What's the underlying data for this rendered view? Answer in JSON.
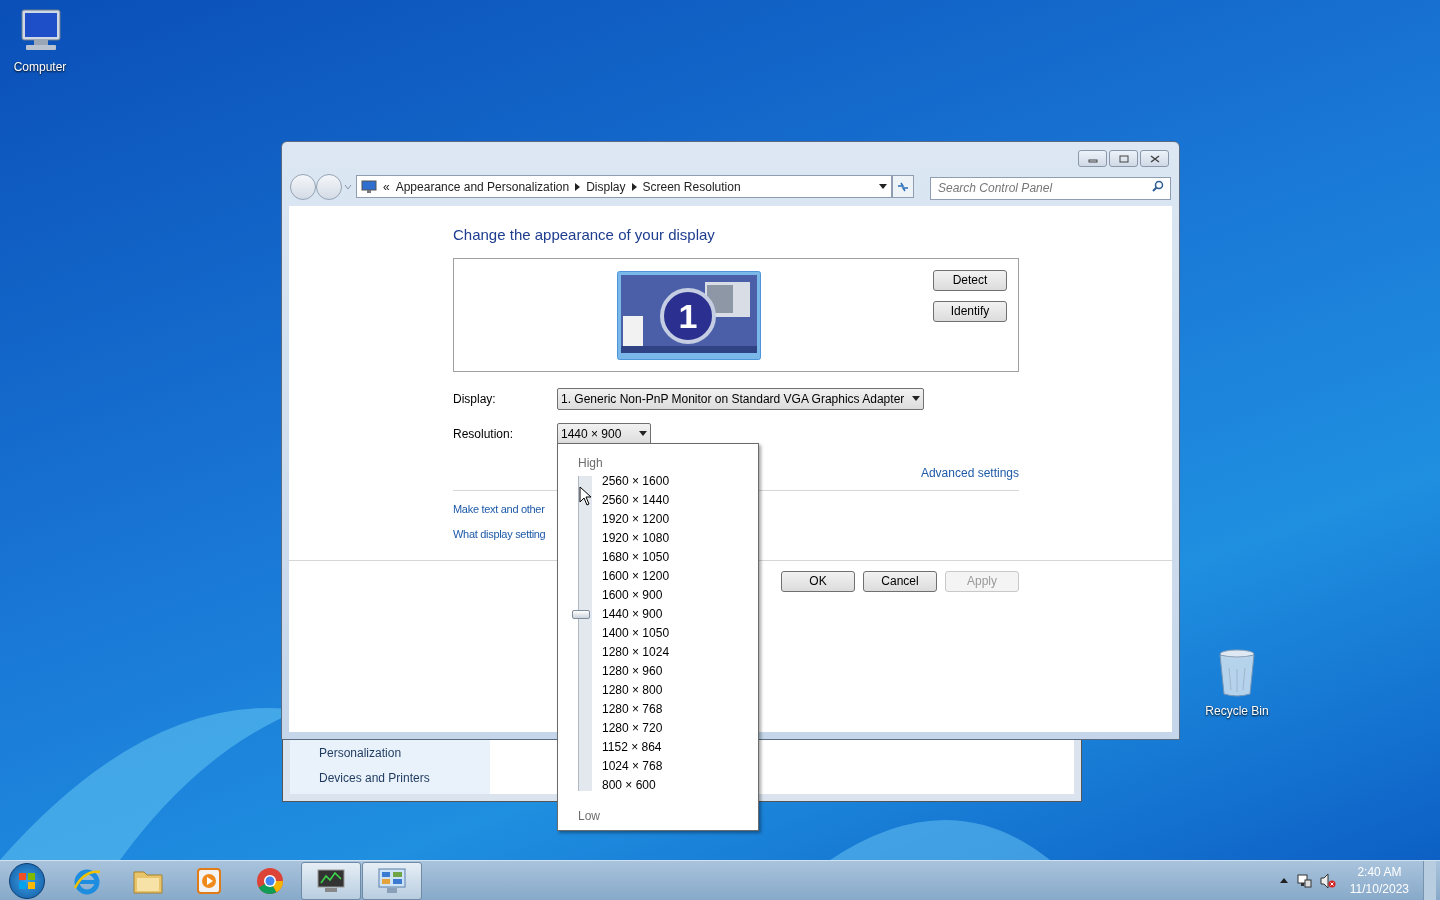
{
  "desktop_icons": [
    {
      "label": "Computer",
      "kind": "computer"
    },
    {
      "label": "Recycle Bin",
      "kind": "recycle"
    }
  ],
  "back_window": {
    "sidebar_items": [
      "Personalization",
      "Devices and Printers"
    ]
  },
  "window": {
    "breadcrumb_prefix": "«",
    "breadcrumb": [
      "Appearance and Personalization",
      "Display",
      "Screen Resolution"
    ],
    "search": {
      "placeholder": "Search Control Panel"
    },
    "heading": "Change the appearance of your display",
    "monitor_number": "1",
    "side_buttons": [
      "Detect",
      "Identify"
    ],
    "display": {
      "label": "Display:",
      "value": "1. Generic Non-PnP Monitor on Standard VGA Graphics Adapter"
    },
    "resolution": {
      "label": "Resolution:",
      "value": "1440 × 900"
    },
    "advanced_link": "Advanced settings",
    "links": [
      "Make text and other",
      "What display setting"
    ],
    "buttons": [
      {
        "label": "OK",
        "disabled": false
      },
      {
        "label": "Cancel",
        "disabled": false
      },
      {
        "label": "Apply",
        "disabled": true
      }
    ]
  },
  "resolution_popup": {
    "high_label": "High",
    "low_label": "Low",
    "level": 0.5625,
    "options": [
      "2560 × 1600",
      "2560 × 1440",
      "1920 × 1200",
      "1920 × 1080",
      "1680 × 1050",
      "1600 × 1200",
      "1600 × 900",
      "1440 × 900",
      "1400 × 1050",
      "1280 × 1024",
      "1280 × 960",
      "1280 × 800",
      "1280 × 768",
      "1280 × 720",
      "1152 × 864",
      "1024 × 768",
      "800 × 600"
    ]
  },
  "taskbar": {
    "apps": [
      {
        "kind": "ie",
        "active": false
      },
      {
        "kind": "folder",
        "active": false
      },
      {
        "kind": "media",
        "active": false
      },
      {
        "kind": "chrome",
        "active": false
      },
      {
        "kind": "monitor",
        "active": true
      },
      {
        "kind": "control",
        "active": true
      }
    ],
    "time": "2:40 AM",
    "date": "11/10/2023"
  }
}
